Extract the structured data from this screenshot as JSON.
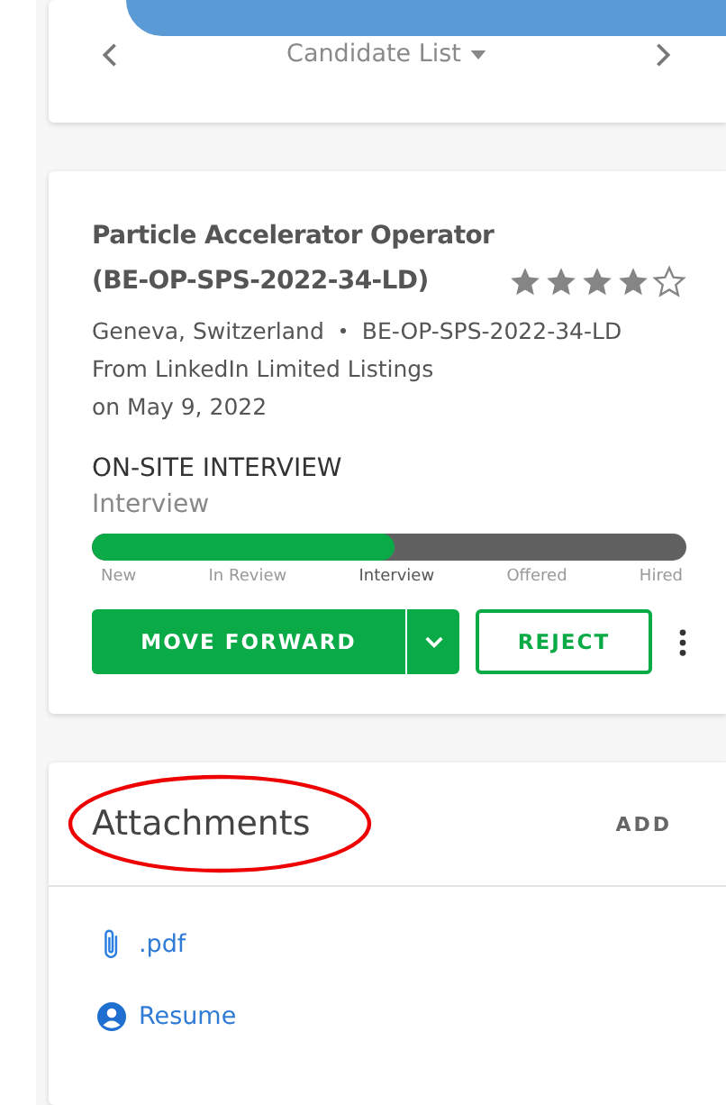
{
  "nav": {
    "title": "Candidate List"
  },
  "job": {
    "title": "Particle Accelerator Operator (BE-OP-SPS-2022-34-LD)",
    "stars": 4,
    "location": "Geneva, Switzerland",
    "code": "BE-OP-SPS-2022-34-LD",
    "source": "From LinkedIn Limited Listings",
    "date": "on May 9, 2022",
    "stage_title": "ON-SITE INTERVIEW",
    "stage": "Interview",
    "level": 0.51,
    "stages": [
      {
        "label": "New",
        "selected": false
      },
      {
        "label": "In Review",
        "selected": false
      },
      {
        "label": "Interview",
        "selected": true
      },
      {
        "label": "Offered",
        "selected": false
      },
      {
        "label": "Hired",
        "selected": false
      }
    ],
    "buttons": {
      "forward": "MOVE FORWARD",
      "reject": "REJECT"
    }
  },
  "attachments": {
    "title": "Attachments",
    "add": "ADD",
    "annotation": {
      "kind": "ellipse"
    },
    "items": [
      {
        "kind": "file",
        "label": ".pdf"
      },
      {
        "kind": "profile",
        "label": "Resume"
      }
    ]
  }
}
